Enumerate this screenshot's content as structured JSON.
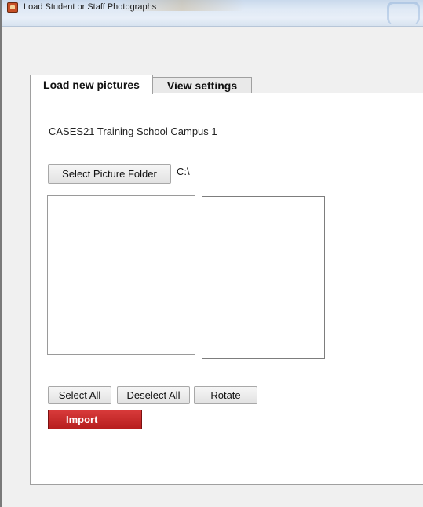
{
  "window": {
    "title": "Load Student or Staff Photographs"
  },
  "tabs": [
    {
      "label": "Load new pictures",
      "active": true
    },
    {
      "label": "View settings",
      "active": false
    }
  ],
  "main": {
    "school_name": "CASES21 Training School Campus 1",
    "select_folder_label": "Select Picture Folder",
    "folder_path": "C:\\",
    "select_all_label": "Select All",
    "deselect_all_label": "Deselect All",
    "rotate_label": "Rotate",
    "import_label": "Import"
  },
  "colors": {
    "import_button": "#c62828",
    "panel_background": "#ffffff",
    "window_background": "#f0f0f0"
  },
  "icons": {
    "app": "app-photo-icon"
  }
}
